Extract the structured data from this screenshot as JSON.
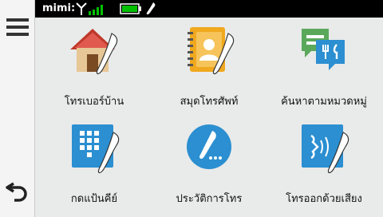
{
  "status_bar": {
    "device_name": "mimi:",
    "signal_icon": "antenna-signal-icon",
    "battery_icon": "battery-full-icon",
    "call_icon": "phone-handset-icon",
    "signal_color": "#00c000",
    "battery_color": "#00c000"
  },
  "sidebar": {
    "menu_icon": "hamburger-menu-icon",
    "back_icon": "back-arrow-icon"
  },
  "grid": {
    "items": [
      {
        "label": "โทรเบอร์บ้าน",
        "icon": "home-phone-icon"
      },
      {
        "label": "สมุดโทรศัพท์",
        "icon": "phonebook-icon"
      },
      {
        "label": "ค้นหาตามหมวดหมู่",
        "icon": "category-search-icon"
      },
      {
        "label": "กดแป้นคีย์",
        "icon": "keypad-icon"
      },
      {
        "label": "ประวัติการโทร",
        "icon": "call-history-icon"
      },
      {
        "label": "โทรออกด้วยเสียง",
        "icon": "voice-dial-icon"
      }
    ]
  },
  "colors": {
    "accent_blue": "#2b8fd1",
    "background": "#e9eaea"
  }
}
